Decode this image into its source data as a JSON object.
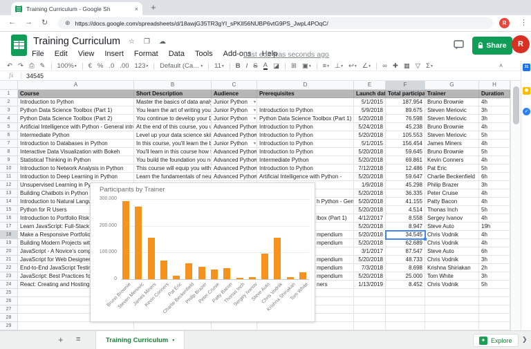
{
  "browser": {
    "tab_title": "Training Curriculum - Google Sh",
    "close_glyph": "×",
    "new_tab_glyph": "+",
    "back_glyph": "←",
    "forward_glyph": "→",
    "reload_glyph": "↻",
    "globe_glyph": "⊕",
    "url": "https://docs.google.com/spreadsheets/d/18awjG35TR3gYI_sPKIl56NUBP6vtG9PS_JwpL4POqC/",
    "avatar_letter": "R",
    "menu_glyph": "⋮"
  },
  "header": {
    "title": "Training Curriculum",
    "star_glyph": "☆",
    "folder_glyph": "❐",
    "cloud_glyph": "☁",
    "menus": [
      "File",
      "Edit",
      "View",
      "Insert",
      "Format",
      "Data",
      "Tools",
      "Add-ons",
      "Help"
    ],
    "last_edit": "Last edit was seconds ago",
    "share_label": "Share",
    "avatar_letter": "R"
  },
  "toolbar": {
    "items": [
      {
        "n": "undo-icon",
        "g": "↶"
      },
      {
        "n": "redo-icon",
        "g": "↷"
      },
      {
        "n": "print-icon",
        "g": "⎙"
      },
      {
        "n": "paint-format-icon",
        "g": "✎"
      },
      {
        "t": "sep"
      },
      {
        "n": "zoom-select",
        "g": "100%",
        "dd": true
      },
      {
        "t": "sep"
      },
      {
        "n": "currency-format-icon",
        "g": "€"
      },
      {
        "n": "percent-format-icon",
        "g": "%"
      },
      {
        "n": "decrease-decimal-icon",
        "g": ".0"
      },
      {
        "n": "increase-decimal-icon",
        "g": ".00"
      },
      {
        "n": "more-formats-icon",
        "g": "123",
        "dd": true
      },
      {
        "t": "sep"
      },
      {
        "n": "font-select",
        "g": "Default (Ca…",
        "dd": true,
        "cls": "font"
      },
      {
        "t": "sep"
      },
      {
        "n": "font-size-select",
        "g": "11",
        "dd": true
      },
      {
        "t": "sep"
      },
      {
        "n": "bold-icon",
        "g": "B",
        "cls": "b"
      },
      {
        "n": "italic-icon",
        "g": "I",
        "cls": "i"
      },
      {
        "n": "strikethrough-icon",
        "g": "S",
        "cls": "strike"
      },
      {
        "n": "text-color-icon",
        "g": "A",
        "cls": "tcolor"
      },
      {
        "n": "fill-color-icon",
        "g": "◪"
      },
      {
        "t": "sep"
      },
      {
        "n": "borders-icon",
        "g": "⊞"
      },
      {
        "n": "merge-cells-icon",
        "g": "▣",
        "dd": true
      },
      {
        "t": "sep"
      },
      {
        "n": "horizontal-align-icon",
        "g": "≡",
        "dd": true
      },
      {
        "n": "vertical-align-icon",
        "g": "⊥",
        "dd": true
      },
      {
        "n": "text-wrap-icon",
        "g": "↩",
        "dd": true
      },
      {
        "n": "text-rotation-icon",
        "g": "∠",
        "dd": true
      },
      {
        "t": "sep"
      },
      {
        "n": "insert-link-icon",
        "g": "∞"
      },
      {
        "n": "insert-comment-icon",
        "g": "✚"
      },
      {
        "n": "insert-chart-icon",
        "g": "▦"
      },
      {
        "n": "filter-icon",
        "g": "▽"
      },
      {
        "n": "functions-icon",
        "g": "Σ",
        "dd": true
      }
    ],
    "collapse_glyph": "˄"
  },
  "formula_bar": {
    "fx": "fx",
    "value": "34545"
  },
  "sheet": {
    "col_letters": [
      "A",
      "B",
      "C",
      "D",
      "E",
      "F",
      "G",
      "H"
    ],
    "header_cells": [
      "Course",
      "Short Description",
      "Audience",
      "Prerequisites",
      "Launch date",
      "Total participants",
      "Trainer",
      "Duration"
    ],
    "selected": {
      "row": 18,
      "col": "F",
      "display_value": "34.545"
    },
    "rows": [
      {
        "n": 2,
        "a": "Introduction to Python",
        "b": "Master the basics of data analysis i",
        "c": "Junior Python",
        "dd": true,
        "d": "",
        "e": "5/1/2015",
        "f": "187.954",
        "g": "Bruno Brownie",
        "h": "4h"
      },
      {
        "n": 3,
        "a": "Python Data Science Toolbox (Part 1)",
        "b": "You learn the art of writing your ov",
        "c": "Junior Python",
        "dd": true,
        "d": "Introduction to Python",
        "e": "5/9/2018",
        "f": "89.675",
        "g": "Steven Meriovic",
        "h": "3h"
      },
      {
        "n": 4,
        "a": "Python Data Science Toolbox (Part 2)",
        "b": "You continue to develop your Data",
        "c": "Junior Python",
        "dd": true,
        "d": "Python Data Science Toolbox (Part 1)",
        "e": "5/20/2018",
        "f": "76.598",
        "g": "Steven Meriovic",
        "h": "3h"
      },
      {
        "n": 5,
        "a": "Artificial Intelligence with Python - General introducti",
        "b": "At the end of this course, you unde",
        "c": "Advanced Python",
        "dd": true,
        "d": "Introduction to Python",
        "e": "5/24/2018",
        "f": "45.238",
        "g": "Bruno Brownie",
        "h": "4h"
      },
      {
        "n": 6,
        "a": "Intermediate Python",
        "b": "Level up your data science skills by",
        "c": "Advanced Python",
        "dd": true,
        "d": "Introduction to Python",
        "e": "5/20/2018",
        "f": "105.553",
        "g": "Steven Meriovic",
        "h": "5h"
      },
      {
        "n": 7,
        "a": "Introduction to Databases in Python",
        "b": "In this course, you'll learn the basic",
        "c": "Junior Python",
        "dd": true,
        "d": "Introduction to Python",
        "e": "5/1/2015",
        "f": "156.454",
        "g": "James Miners",
        "h": "4h"
      },
      {
        "n": 8,
        "a": "Interactive Data Visualization with Bokeh",
        "b": "You'll learn in this course how to cr",
        "c": "Advanced Python",
        "dd": true,
        "d": "Introduction to Python",
        "e": "5/20/2018",
        "f": "59.645",
        "g": "Bruno Brownie",
        "h": "5h"
      },
      {
        "n": 9,
        "a": "Statistical Thinking in Python",
        "b": "You build the foundation you need",
        "c": "Advanced Python",
        "dd": true,
        "d": "Intermediate Python",
        "e": "5/20/2018",
        "f": "69.861",
        "g": "Kevin Conners",
        "h": "4h"
      },
      {
        "n": 10,
        "a": "Introduction to Network Analysis in Python",
        "b": "This course will equip you with the",
        "c": "Advanced Python",
        "dd": true,
        "d": "Introduction to Python",
        "e": "7/12/2018",
        "f": "12.486",
        "g": "Pat Eric",
        "h": "5h"
      },
      {
        "n": 11,
        "a": "Introduction to Deep Learning in Python",
        "b": "Learn the fundamentals of neural r",
        "c": "Advanced Python",
        "dd": true,
        "d": "Artificial Intelligence with Python -",
        "e": "5/20/2018",
        "f": "59.647",
        "g": "Charlie Beckenfield",
        "h": "6h"
      },
      {
        "n": 12,
        "a": "Unsupervised Learning in Python",
        "e": "1/9/2018",
        "f": "45.298",
        "g": "Philip Brazer",
        "h": "3h"
      },
      {
        "n": 13,
        "a": "Building Chatbots in Python",
        "e": "5/20/2018",
        "f": "36.335",
        "g": "Peter Cruise",
        "h": "4h"
      },
      {
        "n": 14,
        "a": "Introduction to Natural Language",
        "d": "h Python - Gene",
        "d_off": true,
        "e": "5/20/2018",
        "f": "41.155",
        "g": "Patty Bacon",
        "h": "4h"
      },
      {
        "n": 15,
        "a": "Python for R Users",
        "e": "5/20/2018",
        "f": "4.514",
        "g": "Thonas Inch",
        "h": "5h"
      },
      {
        "n": 16,
        "a": "Introduction to Portfolio Risk Man",
        "d": "lbox (Part 1)",
        "d_off": true,
        "e": "4/12/2017",
        "f": "8.558",
        "g": "Sergey Ivanov",
        "h": "4h"
      },
      {
        "n": 17,
        "a": "Learn JavaScript: Full-Stack from S",
        "e": "5/20/2018",
        "f": "8.947",
        "g": "Steve Auto",
        "h": "19h"
      },
      {
        "n": 18,
        "a": "Make a Responsive Portfolio Web",
        "d": "mpendium",
        "d_off": true,
        "e": "5/20/2018",
        "f": "34.545",
        "g": "Chris Vodnik",
        "h": "4h"
      },
      {
        "n": 19,
        "a": "Building Modern Projects with Re",
        "d": "mpendium",
        "d_off": true,
        "e": "5/20/2018",
        "f": "62.689",
        "g": "Chris Vodnik",
        "h": "4h"
      },
      {
        "n": 20,
        "a": "JavaScript - A Novice's compendiu",
        "e": "3/1/2017",
        "f": "87.547",
        "g": "Steve Auto",
        "h": "6h"
      },
      {
        "n": 21,
        "a": "JavaScript for Web Designers",
        "d": "mpendium",
        "d_off": true,
        "e": "5/20/2018",
        "f": "48.733",
        "g": "Chris Vodnik",
        "h": "3h"
      },
      {
        "n": 22,
        "a": "End-to-End JavaScript Testing with",
        "d": "mpendium",
        "d_off": true,
        "e": "7/3/2018",
        "f": "8.698",
        "g": "Krishna Shiriakan",
        "h": "2h"
      },
      {
        "n": 23,
        "a": "JavaScript: Best Practices for Code",
        "d": "mpendium",
        "d_off": true,
        "e": "5/20/2018",
        "f": "25.000",
        "g": "Tom White",
        "h": "3h"
      },
      {
        "n": 24,
        "a": "React: Creating and Hosting a Full-",
        "d": "ners",
        "d_off": true,
        "e": "1/13/2019",
        "f": "8.452",
        "g": "Chris Vodnik",
        "h": "5h"
      }
    ]
  },
  "chart_data": {
    "type": "bar",
    "title": "Participants by Trainer",
    "categories": [
      "Bruno Brownie",
      "Steven Meriovic",
      "James Miners",
      "Kevin Conners",
      "Pat Eric",
      "Charlie Beckenfield",
      "Philip Brazer",
      "Peter Cruise",
      "Patty Bacon",
      "Thonas Inch",
      "Sergey Ivanov",
      "Steve Auto",
      "Chris Vodnik",
      "Krishna Shiriakan",
      "Tom White"
    ],
    "values": [
      292837,
      271826,
      156454,
      69861,
      12486,
      59647,
      45298,
      36335,
      41155,
      4514,
      8558,
      96494,
      154419,
      8698,
      25000
    ],
    "yticks": [
      {
        "v": 0,
        "label": "0"
      },
      {
        "v": 100000,
        "label": "100.000"
      },
      {
        "v": 200000,
        "label": "200.000"
      },
      {
        "v": 300000,
        "label": "300.000"
      }
    ],
    "ylim": [
      0,
      300000
    ],
    "xlabel": "",
    "ylabel": "",
    "grid": true,
    "legend": "none",
    "bar_color": "#f6921e"
  },
  "side_panel": {
    "calendar_day": "31",
    "tasks_check": "✓"
  },
  "bottom_bar": {
    "add_glyph": "+",
    "all_sheets_glyph": "≡",
    "sheet_tab": "Training Curriculum",
    "tab_dd": "▾",
    "explore_label": "Explore",
    "explore_glyph": "✦",
    "scroll_right_glyph": "❯"
  }
}
